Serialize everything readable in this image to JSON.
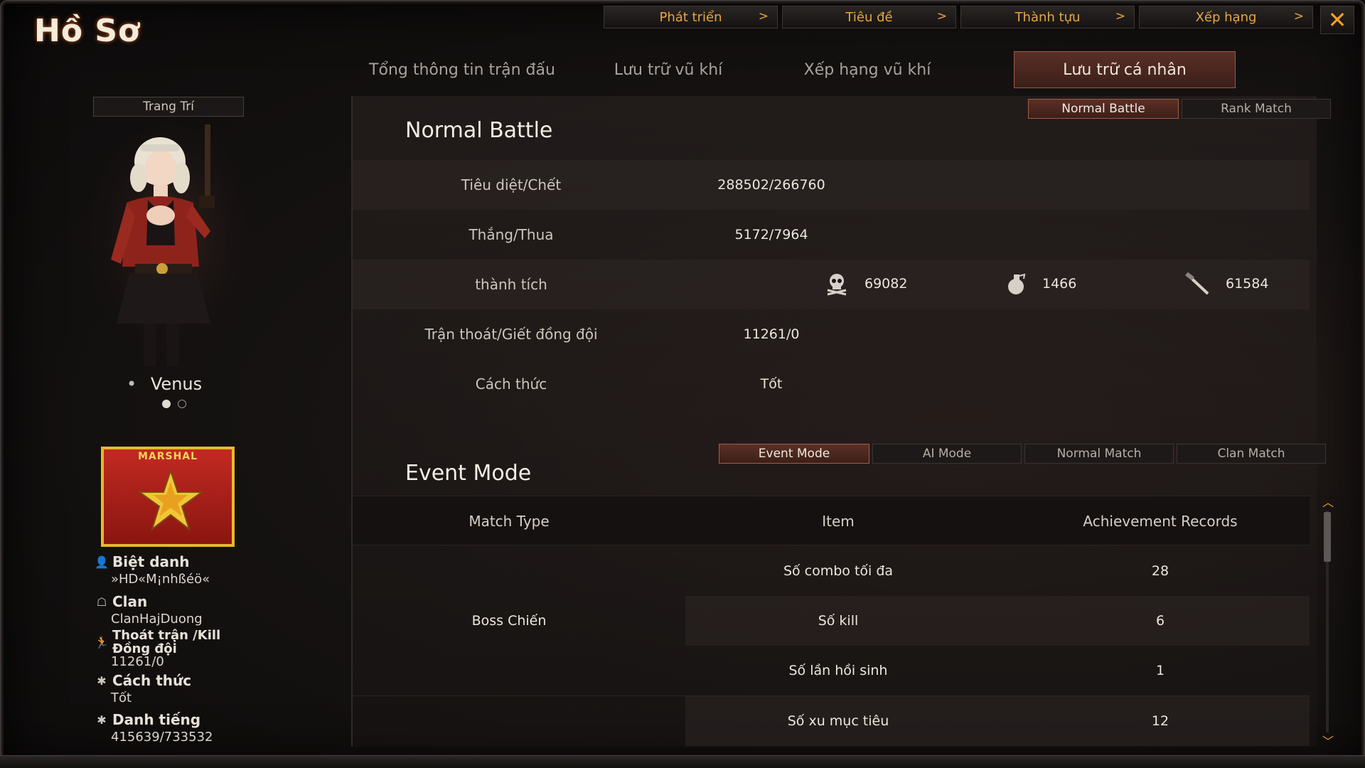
{
  "window": {
    "title": "Hồ Sơ",
    "close_icon": "close-icon"
  },
  "topnav": [
    {
      "label": "Phát triển",
      "chevron": ">"
    },
    {
      "label": "Tiêu đề",
      "chevron": ">"
    },
    {
      "label": "Thành tựu",
      "chevron": ">"
    },
    {
      "label": "Xếp hạng",
      "chevron": ">"
    }
  ],
  "tabs": [
    {
      "label": "Tổng thông tin trận đấu",
      "active": false
    },
    {
      "label": "Lưu trữ vũ khí",
      "active": false
    },
    {
      "label": "Xếp hạng vũ khí",
      "active": false
    },
    {
      "label": "Lưu trữ cá nhân",
      "active": true
    }
  ],
  "profile": {
    "decorate_label": "Trang Trí",
    "character_name": "Venus",
    "rank_label": "MARSHAL",
    "fields": [
      {
        "label": "Biệt danh",
        "value": "»HD«M¡nhßéö«",
        "icon": "person-icon"
      },
      {
        "label": "Clan",
        "value": "ClanHajDuong",
        "icon": "clan-icon"
      },
      {
        "label": "Thoát trận /Kill Đồng đội",
        "value": "11261/0",
        "icon": "running-icon"
      },
      {
        "label": "Cách thức",
        "value": "Tốt",
        "icon": "gear-icon"
      },
      {
        "label": "Danh tiếng",
        "value": "415639/733532",
        "icon": "gear-icon"
      }
    ]
  },
  "battle_mode_tabs": [
    {
      "label": "Normal Battle",
      "active": true
    },
    {
      "label": "Rank Match",
      "active": false
    }
  ],
  "normal_battle": {
    "title": "Normal Battle",
    "rows": [
      {
        "label": "Tiêu diệt/Chết",
        "value": "288502/266760"
      },
      {
        "label": "Thắng/Thua",
        "value": "5172/7964"
      },
      {
        "label": "thành tích",
        "value": ""
      },
      {
        "label": "Trận thoát/Giết đồng đội",
        "value": "11261/0"
      },
      {
        "label": "Cách thức",
        "value": "Tốt"
      }
    ],
    "achievements": [
      {
        "icon": "skull-icon",
        "value": "69082"
      },
      {
        "icon": "grenade-icon",
        "value": "1466"
      },
      {
        "icon": "knife-icon",
        "value": "61584"
      }
    ]
  },
  "event_mode_tabs": [
    {
      "label": "Event Mode",
      "active": true
    },
    {
      "label": "AI Mode",
      "active": false
    },
    {
      "label": "Normal Match",
      "active": false
    },
    {
      "label": "Clan Match",
      "active": false
    }
  ],
  "event_mode": {
    "title": "Event Mode",
    "columns": [
      "Match Type",
      "Item",
      "Achievement Records"
    ],
    "group": "Boss Chiến",
    "rows": [
      {
        "item": "Số combo tối đa",
        "record": "28"
      },
      {
        "item": "Số kill",
        "record": "6"
      },
      {
        "item": "Số lần hồi sinh",
        "record": "1"
      },
      {
        "item": "Số xu mục tiêu",
        "record": "12"
      }
    ]
  },
  "colors": {
    "accent": "#e8a640",
    "active_tab": "#5a3026",
    "rank_badge": "#c22a22",
    "rank_border": "#e8b82c"
  }
}
